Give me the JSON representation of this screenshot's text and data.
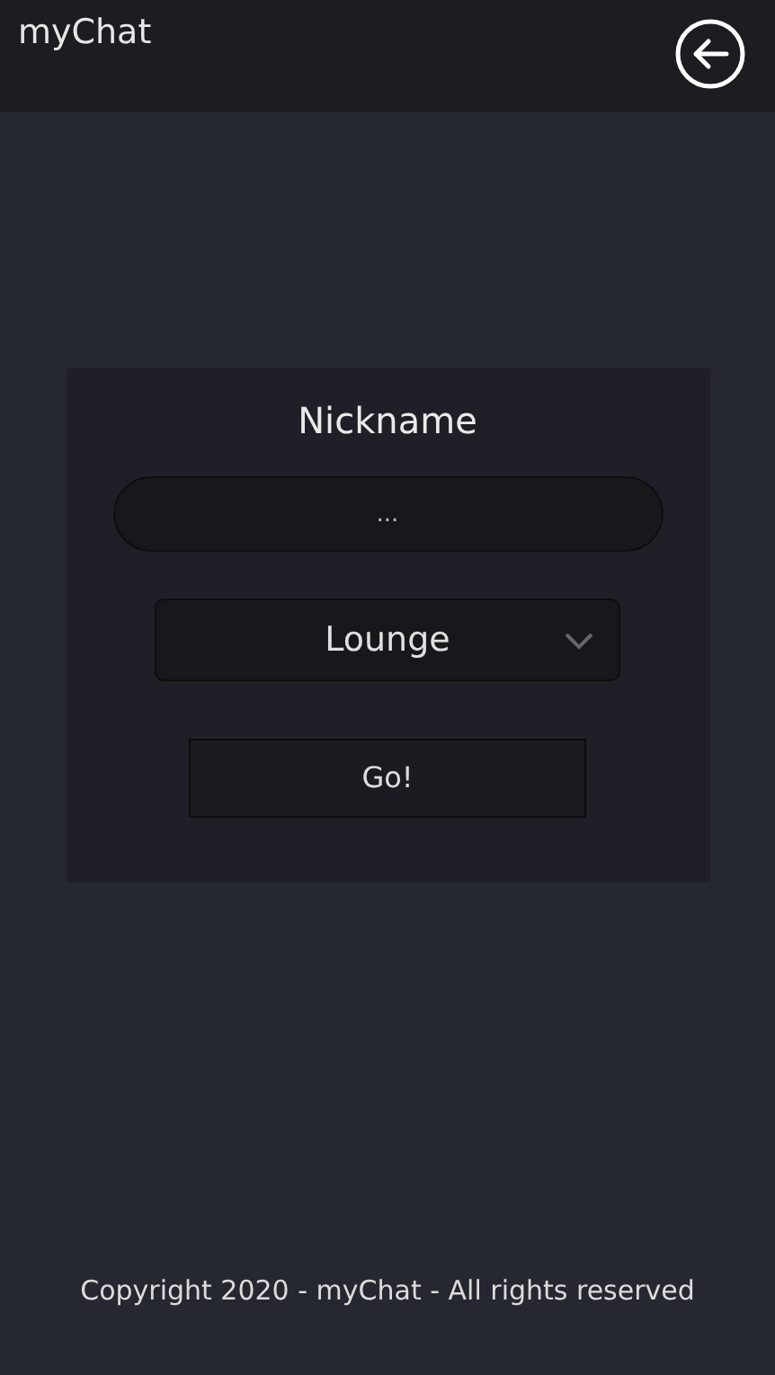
{
  "header": {
    "title": "myChat"
  },
  "form": {
    "label": "Nickname",
    "nickname": {
      "placeholder": "..."
    },
    "room": {
      "value": "Lounge"
    },
    "submit": "Go!"
  },
  "footer": "Copyright 2020 - myChat - All rights reserved"
}
